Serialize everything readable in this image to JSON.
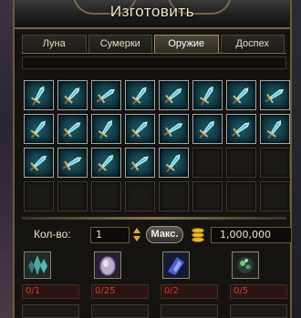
{
  "window": {
    "title": "Изготовить"
  },
  "tabs": [
    {
      "label": "Луна",
      "active": false
    },
    {
      "label": "Сумерки",
      "active": false
    },
    {
      "label": "Оружие",
      "active": true
    },
    {
      "label": "Доспех",
      "active": false
    }
  ],
  "recipe_grid": {
    "items": [
      {
        "icon": "scythe-icon"
      },
      {
        "icon": "lance-icon"
      },
      {
        "icon": "sword-icon"
      },
      {
        "icon": "greatsword-icon"
      },
      {
        "icon": "staff-icon"
      },
      {
        "icon": "crossbow-icon"
      },
      {
        "icon": "dual-blades-icon"
      },
      {
        "icon": "axe-icon"
      },
      {
        "icon": "spear-icon"
      },
      {
        "icon": "bow-icon"
      },
      {
        "icon": "halberd-icon"
      },
      {
        "icon": "winged-sword-icon"
      },
      {
        "icon": "bow-icon"
      },
      {
        "icon": "dagger-icon"
      },
      {
        "icon": "claws-icon"
      },
      {
        "icon": "blade-icon"
      },
      {
        "icon": "fist-icon"
      },
      {
        "icon": "orb-staff-icon"
      },
      {
        "icon": "shield-icon"
      },
      {
        "icon": "crossed-blades-icon"
      },
      {
        "icon": "wings-icon"
      }
    ],
    "empty_slots_shown": 11
  },
  "craft": {
    "qty_label": "Кол-во:",
    "qty_value": "1",
    "max_label": "Макс.",
    "gold_value": "1,000,000"
  },
  "materials": [
    {
      "icon": "crystal-cluster-icon",
      "count": "0/1"
    },
    {
      "icon": "egg-icon",
      "count": "0/25"
    },
    {
      "icon": "blue-essence-icon",
      "count": "0/2"
    },
    {
      "icon": "green-ore-icon",
      "count": "0/5"
    }
  ],
  "colors": {
    "accent": "#a58d5e",
    "missing": "#d03a30",
    "gold": "#e8b830"
  }
}
